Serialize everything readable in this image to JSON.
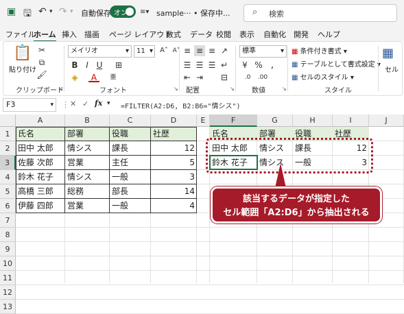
{
  "titlebar": {
    "autosave_label": "自動保存",
    "autosave_state": "オン",
    "doc_title": "sample··· • 保存中...",
    "search_placeholder": "検索"
  },
  "menu": {
    "tabs": [
      "ファイル",
      "ホーム",
      "挿入",
      "描画",
      "ページ レイアウト",
      "数式",
      "データ",
      "校閲",
      "表示",
      "自動化",
      "開発",
      "ヘルプ"
    ],
    "active_tab": "ホーム"
  },
  "ribbon": {
    "clipboard": {
      "paste": "貼り付け",
      "label": "クリップボード"
    },
    "font": {
      "name": "メイリオ",
      "size": "11",
      "label": "フォント"
    },
    "alignment": {
      "label": "配置"
    },
    "number": {
      "format": "標準",
      "label": "数値"
    },
    "styles": {
      "conditional": "条件付き書式",
      "table": "テーブルとして書式設定",
      "cell_style": "セルのスタイル",
      "label": "スタイル"
    },
    "cells": {
      "label": "セル"
    }
  },
  "formula_bar": {
    "name_box": "F3",
    "fx": "fx",
    "formula": "=FILTER(A2:D6, B2:B6=\"情シス\")"
  },
  "grid": {
    "columns": [
      "A",
      "B",
      "C",
      "D",
      "E",
      "F",
      "G",
      "H",
      "I",
      "J"
    ],
    "rows": [
      "1",
      "2",
      "3",
      "4",
      "5",
      "6",
      "7",
      "8",
      "9",
      "10",
      "11",
      "12",
      "13"
    ],
    "source_table": {
      "headers": [
        "氏名",
        "部署",
        "役職",
        "社歴"
      ],
      "rows": [
        [
          "田中 太郎",
          "情シス",
          "課長",
          "12"
        ],
        [
          "佐藤 次郎",
          "営業",
          "主任",
          "5"
        ],
        [
          "鈴木 花子",
          "情シス",
          "一般",
          "3"
        ],
        [
          "高橋 三郎",
          "総務",
          "部長",
          "14"
        ],
        [
          "伊藤 四郎",
          "営業",
          "一般",
          "4"
        ]
      ]
    },
    "result_table": {
      "headers": [
        "氏名",
        "部署",
        "役職",
        "社歴"
      ],
      "rows": [
        [
          "田中 太郎",
          "情シス",
          "課長",
          "12"
        ],
        [
          "鈴木 花子",
          "情シス",
          "一般",
          "3"
        ]
      ]
    }
  },
  "annotation": {
    "line1": "該当するデータが指定した",
    "line2": "セル範囲「A2:D6」から抽出される"
  },
  "colors": {
    "accent": "#1e7145",
    "header_fill": "#e2efda",
    "callout": "#a61b29"
  }
}
